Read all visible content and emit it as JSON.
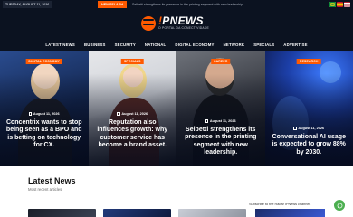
{
  "topbar": {
    "date": "TUESDAY, AUGUST 11, 2026",
    "news_label": "NEWSFLASH",
    "ticker": "Selbetti strengthens its presence in the printing segment with new leadership",
    "flags": [
      "brazil-flag-icon",
      "spain-flag-icon",
      "usa-flag-icon"
    ]
  },
  "brand": {
    "logo_prefix": "!",
    "logo_main": "PNEWS",
    "tagline": "O PORTAL DA CONECTIVIDADE"
  },
  "nav": {
    "items": [
      "LATEST NEWS",
      "BUSINESS",
      "SECURITY",
      "NATIONAL",
      "DIGITAL ECONOMY",
      "NETWORK",
      "SPECIALS",
      "ADVERTISE"
    ]
  },
  "hero": {
    "cards": [
      {
        "badge": "DIGITAL ECONOMY",
        "date": "August 11, 2026",
        "title": "Concentrix wants to stop being seen as a BPO and is betting on technology for CX."
      },
      {
        "badge": "SPECIALS",
        "date": "August 11, 2026",
        "title": "Reputation also influences growth: why customer service has become a brand asset."
      },
      {
        "badge": "CAREER",
        "date": "August 11, 2026",
        "title": "Selbetti strengthens its presence in the printing segment with new leadership."
      },
      {
        "badge": "RESEARCH",
        "date": "August 11, 2026",
        "title": "Conversational AI usage is expected to grow 88% by 2030."
      }
    ]
  },
  "latest": {
    "title": "Latest News",
    "subtitle": "Most recent articles"
  },
  "sidebar": {
    "subscribe_text": "Subscribe to the Radar IPNews channel."
  },
  "colors": {
    "accent": "#ff5a00",
    "header_bg": "#0b1220",
    "chat_green": "#4caf50"
  }
}
